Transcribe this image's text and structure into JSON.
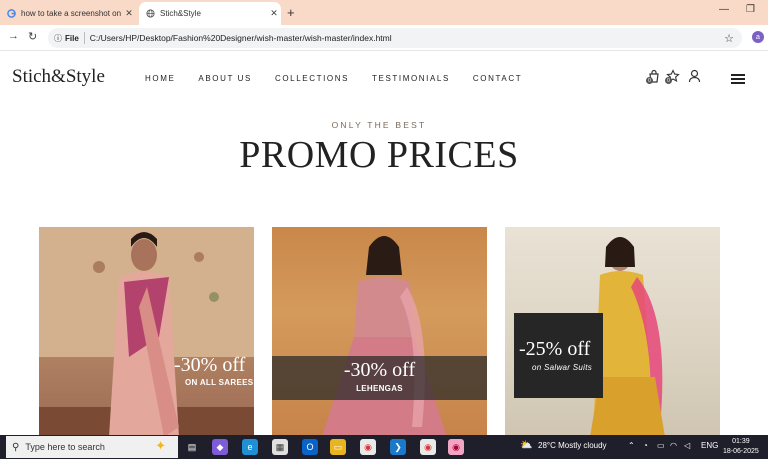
{
  "browser": {
    "tabs": [
      {
        "title": "how to take a screenshot on wi",
        "favicon": "google-icon",
        "active": false
      },
      {
        "title": "Stich&Style",
        "favicon": "globe-icon",
        "active": true
      }
    ],
    "new_tab": "+",
    "address": {
      "scheme_label": "File",
      "url": "C:/Users/HP/Desktop/Fashion%20Designer/wish-master/wish-master/index.html"
    },
    "profile_initial": "a"
  },
  "site": {
    "logo": "Stich&Style",
    "menu": [
      "HOME",
      "ABOUT US",
      "COLLECTIONS",
      "TESTIMONIALS",
      "CONTACT"
    ],
    "cart_count": "0",
    "wishlist_count": "0",
    "kicker": "ONLY THE BEST",
    "heading": "PROMO PRICES",
    "promos": [
      {
        "discount": "-30% off",
        "label": "ON ALL SAREES"
      },
      {
        "discount": "-30% off",
        "label": "LEHENGAS"
      },
      {
        "discount": "-25% off",
        "label": "on Salwar Suits"
      }
    ]
  },
  "taskbar": {
    "search_placeholder": "Type here to search",
    "weather": "28°C  Mostly cloudy",
    "language": "ENG",
    "time": "01:39",
    "date": "18-06-2025"
  },
  "colors": {
    "tab_strip": "#f9d9c7",
    "taskbar": "#1f1f2b",
    "profile": "#7b61c2"
  }
}
